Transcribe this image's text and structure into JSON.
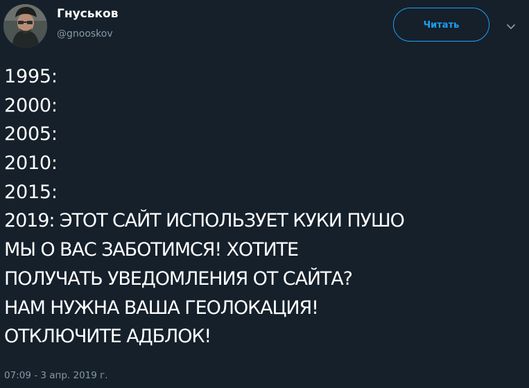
{
  "user": {
    "name": "Гнуськов",
    "handle": "@gnooskov",
    "avatar_alt": "user avatar"
  },
  "actions": {
    "follow_label": "Читать",
    "more_icon": "chevron-down-icon"
  },
  "tweet": {
    "lines": [
      "1995:",
      "2000:",
      "2005:",
      "2010:",
      "2015:",
      "2019: ЭТОТ САЙТ ИСПОЛЬЗУЕТ КУКИ ПУШО",
      "МЫ О ВАС ЗАБОТИМСЯ! ХОТИТЕ",
      "ПОЛУЧАТЬ УВЕДОМЛЕНИЯ ОТ САЙТА?",
      "НАМ НУЖНА ВАША ГЕОЛОКАЦИЯ!",
      "ОТКЛЮЧИТЕ АДБЛОК!"
    ],
    "timestamp": "07:09 - 3 апр. 2019 г."
  },
  "colors": {
    "background": "#15202b",
    "text": "#ffffff",
    "secondary_text": "#8899a6",
    "accent": "#1da1f2"
  }
}
